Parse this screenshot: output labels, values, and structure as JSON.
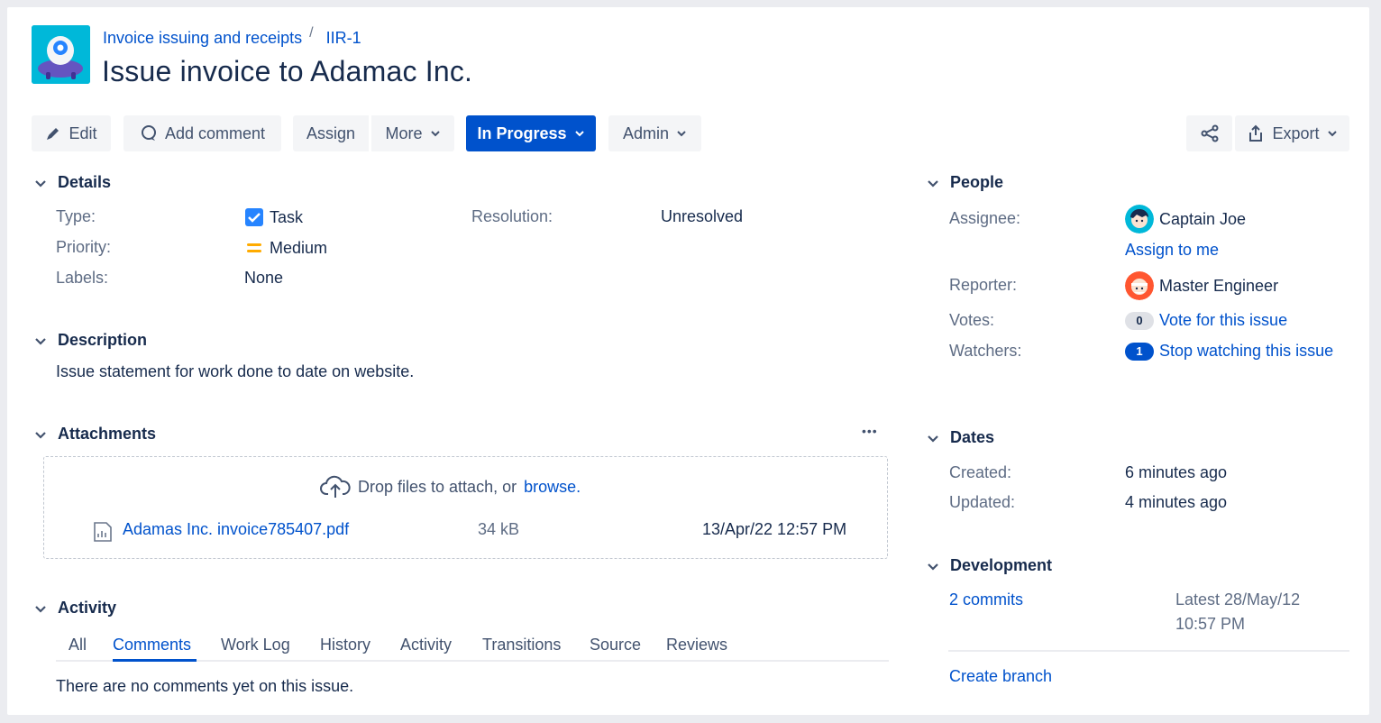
{
  "header": {
    "breadcrumb_project": "Invoice issuing and receipts",
    "breadcrumb_separator": "/",
    "breadcrumb_issue": "IIR-1",
    "title": "Issue invoice to Adamac Inc."
  },
  "toolbar": {
    "edit": "Edit",
    "add_comment": "Add comment",
    "assign": "Assign",
    "more": "More",
    "status": "In Progress",
    "admin": "Admin",
    "export": "Export"
  },
  "details": {
    "heading": "Details",
    "type_label": "Type:",
    "type_value": "Task",
    "priority_label": "Priority:",
    "priority_value": "Medium",
    "labels_label": "Labels:",
    "labels_value": "None",
    "resolution_label": "Resolution:",
    "resolution_value": "Unresolved"
  },
  "description": {
    "heading": "Description",
    "text": "Issue statement for work done to date on website."
  },
  "attachments": {
    "heading": "Attachments",
    "more": "•••",
    "drop_text": "Drop files to attach, or",
    "browse": "browse.",
    "files": [
      {
        "name": "Adamas Inc. invoice785407.pdf",
        "size": "34 kB",
        "date": "13/Apr/22 12:57 PM"
      }
    ]
  },
  "activity": {
    "heading": "Activity",
    "tabs": [
      "All",
      "Comments",
      "Work Log",
      "History",
      "Activity",
      "Transitions",
      "Source",
      "Reviews"
    ],
    "active_tab": "Comments",
    "empty_text": "There are no comments yet on this issue."
  },
  "people": {
    "heading": "People",
    "assignee_label": "Assignee:",
    "assignee_value": "Captain Joe",
    "assign_to_me": "Assign to me",
    "reporter_label": "Reporter:",
    "reporter_value": "Master Engineer",
    "votes_label": "Votes:",
    "votes_count": "0",
    "votes_link": "Vote for this issue",
    "watchers_label": "Watchers:",
    "watchers_count": "1",
    "watchers_link": "Stop watching this issue"
  },
  "dates": {
    "heading": "Dates",
    "created_label": "Created:",
    "created_value": "6 minutes ago",
    "updated_label": "Updated:",
    "updated_value": "4 minutes ago"
  },
  "development": {
    "heading": "Development",
    "commits": "2 commits",
    "latest_line1": "Latest 28/May/12",
    "latest_line2": "10:57 PM",
    "create_branch": "Create branch"
  },
  "colors": {
    "primary": "#0052cc",
    "text": "#172b4d",
    "muted": "#5e6c84",
    "button_bg": "#f4f5f7",
    "priority_medium": "#ffab00"
  }
}
